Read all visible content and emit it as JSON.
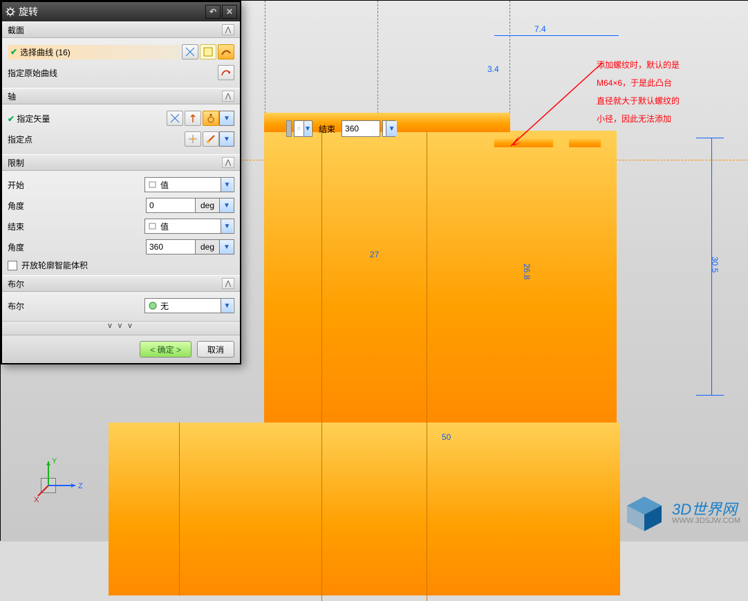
{
  "dialog": {
    "title": "旋转",
    "section_section": {
      "title": "截面",
      "pick_curve": {
        "label": "选择曲线 (16)"
      },
      "orig_curve": {
        "label": "指定原始曲线"
      }
    },
    "section_axis": {
      "title": "轴",
      "vector": {
        "label": "指定矢量"
      },
      "point": {
        "label": "指定点"
      }
    },
    "section_limits": {
      "title": "限制",
      "start": {
        "label": "开始",
        "combo": "值"
      },
      "start_angle": {
        "label": "角度",
        "value": "0",
        "unit": "deg"
      },
      "end": {
        "label": "结束",
        "combo": "值"
      },
      "end_angle": {
        "label": "角度",
        "value": "360",
        "unit": "deg"
      },
      "open_vol": {
        "label": "开放轮廓智能体积"
      }
    },
    "section_boolean": {
      "title": "布尔",
      "boolean": {
        "label": "布尔",
        "combo": "无"
      }
    },
    "buttons": {
      "ok": "< 确定 >",
      "cancel": "取消"
    }
  },
  "float_input": {
    "label": "结束",
    "value": "360"
  },
  "dimensions": {
    "d7_4": "7.4",
    "d3_4": "3.4",
    "d27": "27",
    "d26_8": "26.8",
    "d30_5": "30.5",
    "d50": "50"
  },
  "annotation": {
    "l1": "添加螺纹时，默认的是",
    "l2": "M64×6，于是此凸台",
    "l3": "直径就大于默认螺纹的",
    "l4": "小径，因此无法添加"
  },
  "csys": {
    "x": "X",
    "y": "Y",
    "z": "Z"
  },
  "logo": {
    "main": "3D世界网",
    "url": "WWW.3DSJW.COM"
  }
}
